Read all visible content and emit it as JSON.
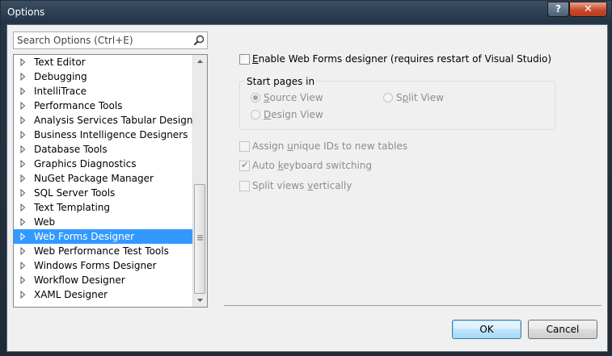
{
  "window": {
    "title": "Options",
    "help_label": "?",
    "close_label": "✕"
  },
  "search": {
    "placeholder": "Search Options (Ctrl+E)",
    "icon": "magnifier-icon"
  },
  "tree": {
    "items": [
      {
        "label": "Text Editor"
      },
      {
        "label": "Debugging"
      },
      {
        "label": "IntelliTrace"
      },
      {
        "label": "Performance Tools"
      },
      {
        "label": "Analysis Services Tabular Designers"
      },
      {
        "label": "Business Intelligence Designers"
      },
      {
        "label": "Database Tools"
      },
      {
        "label": "Graphics Diagnostics"
      },
      {
        "label": "NuGet Package Manager"
      },
      {
        "label": "SQL Server Tools"
      },
      {
        "label": "Text Templating"
      },
      {
        "label": "Web"
      },
      {
        "label": "Web Forms Designer",
        "selected": true
      },
      {
        "label": "Web Performance Test Tools"
      },
      {
        "label": "Windows Forms Designer"
      },
      {
        "label": "Workflow Designer"
      },
      {
        "label": "XAML Designer"
      }
    ],
    "selected_index": 12
  },
  "settings": {
    "enable": {
      "label_pre": "",
      "label_key": "E",
      "label_post": "nable Web Forms designer (requires restart of Visual Studio)",
      "checked": false
    },
    "start_pages": {
      "title": "Start pages in",
      "source": {
        "label_pre": "",
        "label_key": "S",
        "label_post": "ource View",
        "selected": true
      },
      "design": {
        "label_pre": "",
        "label_key": "D",
        "label_post": "esign View",
        "selected": false
      },
      "split": {
        "label_pre": "S",
        "label_key": "p",
        "label_post": "lit View",
        "selected": false
      }
    },
    "assign_ids": {
      "label_pre": "Assign ",
      "label_key": "u",
      "label_post": "nique IDs to new tables",
      "checked": false
    },
    "auto_keyboard": {
      "label_pre": "Auto ",
      "label_key": "k",
      "label_post": "eyboard switching",
      "checked": true
    },
    "split_vertical": {
      "label_pre": "Split views ",
      "label_key": "v",
      "label_post": "ertically",
      "checked": false
    }
  },
  "buttons": {
    "ok": "OK",
    "cancel": "Cancel"
  },
  "colors": {
    "selection": "#3399ff",
    "disabled_text": "#8d8d8d"
  }
}
